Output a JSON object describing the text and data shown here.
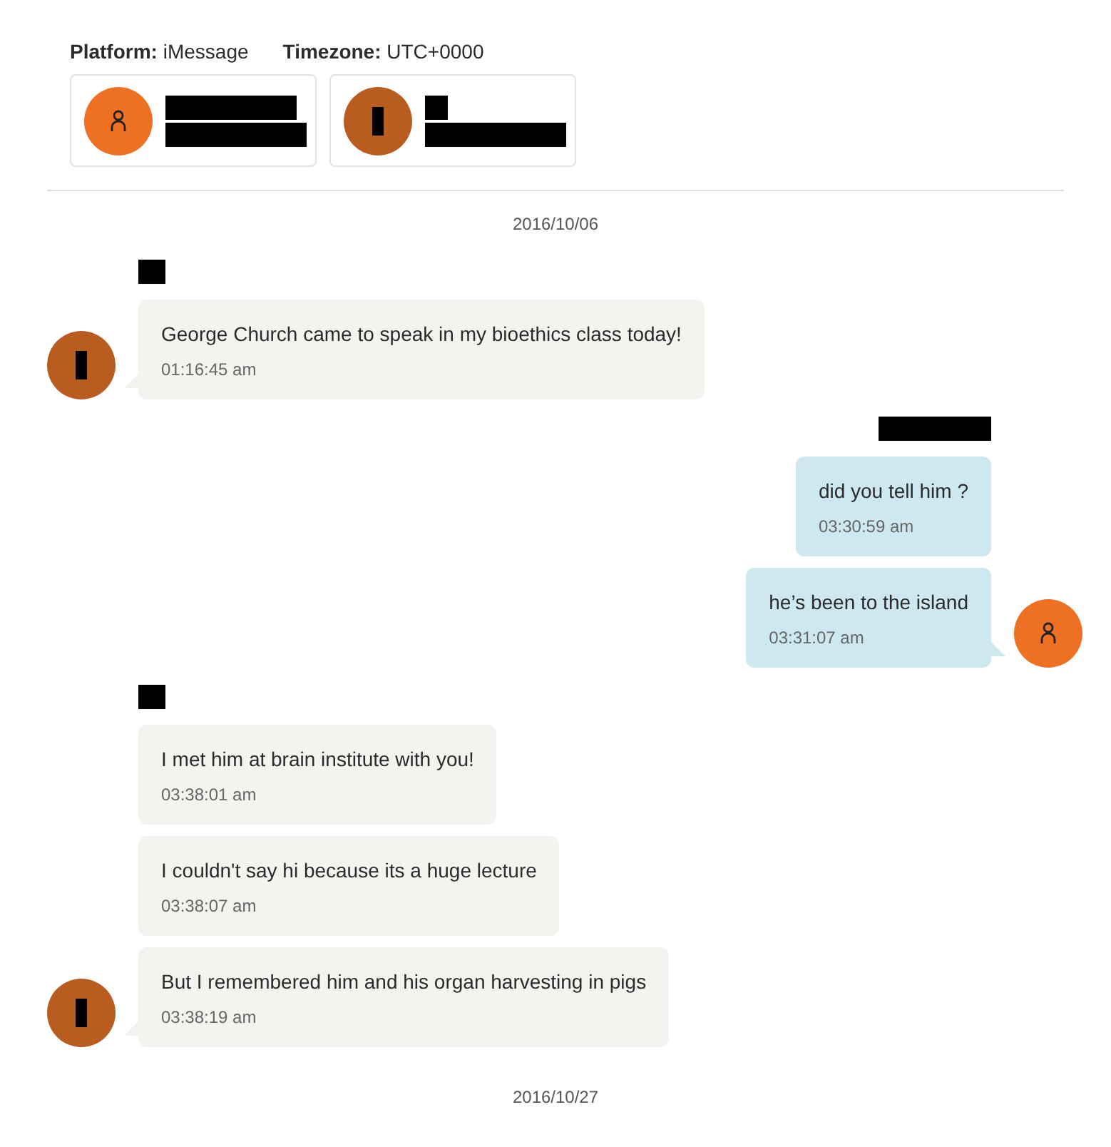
{
  "header": {
    "platform_label": "Platform:",
    "platform": "iMessage",
    "timezone_label": "Timezone:",
    "timezone": "UTC+0000"
  },
  "participants": [
    {
      "avatar_redacted": false,
      "color": "#ee7023",
      "name_redacted": true
    },
    {
      "avatar_redacted": true,
      "color": "#b85c20",
      "name_redacted": true
    }
  ],
  "timeline": [
    {
      "kind": "date",
      "text": "2016/10/06"
    },
    {
      "kind": "group",
      "outgoing": false,
      "avatar_redacted": true,
      "color": "#b85c20",
      "messages": [
        {
          "text": "George Church came to speak in my bioethics class today!",
          "time": "01:16:45 am"
        }
      ]
    },
    {
      "kind": "group",
      "outgoing": true,
      "avatar_redacted": false,
      "color": "#ee7023",
      "messages": [
        {
          "text": "did you tell him ?",
          "time": "03:30:59 am"
        },
        {
          "text": "he’s been to the island",
          "time": "03:31:07 am"
        }
      ]
    },
    {
      "kind": "group",
      "outgoing": false,
      "avatar_redacted": true,
      "color": "#b85c20",
      "messages": [
        {
          "text": "I met him at brain institute with you!",
          "time": "03:38:01 am"
        },
        {
          "text": "I couldn't say hi because its a huge lecture",
          "time": "03:38:07 am"
        },
        {
          "text": "But I remembered him and his organ harvesting in pigs",
          "time": "03:38:19 am"
        }
      ]
    },
    {
      "kind": "date",
      "text": "2016/10/27"
    }
  ]
}
